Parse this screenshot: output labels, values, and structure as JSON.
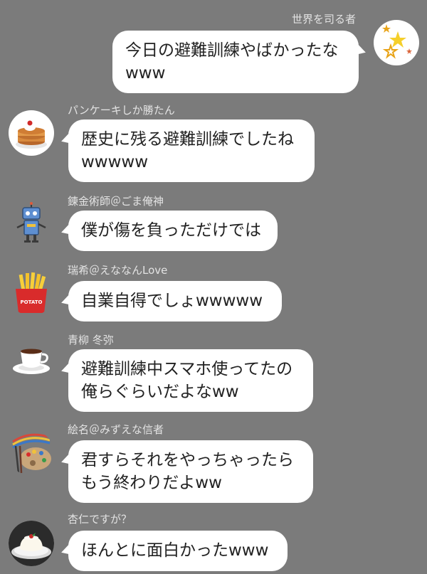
{
  "messages": [
    {
      "sender": "世界を司る者",
      "avatar_icon": "stars-avatar-icon",
      "lines": [
        "今日の避難訓練やばかったな",
        "www"
      ]
    },
    {
      "sender": "パンケーキしか勝たん",
      "avatar_icon": "pancake-avatar-icon",
      "lines": [
        "歴史に残る避難訓練でしたね",
        "wwwww"
      ]
    },
    {
      "sender": "錬金術師＠ごま俺神",
      "avatar_icon": "robot-avatar-icon",
      "lines": [
        "僕が傷を負っただけでは"
      ]
    },
    {
      "sender": "瑞希＠えななんLove",
      "avatar_icon": "fries-avatar-icon",
      "avatar_text": "POTATO",
      "lines": [
        "自業自得でしょwwwww"
      ]
    },
    {
      "sender": "青柳 冬弥",
      "avatar_icon": "coffee-avatar-icon",
      "lines": [
        "避難訓練中スマホ使ってたの",
        "俺らぐらいだよなww"
      ]
    },
    {
      "sender": "絵名＠みずえな信者",
      "avatar_icon": "palette-avatar-icon",
      "lines": [
        "君すらそれをやっちゃったら",
        "もう終わりだよww"
      ]
    },
    {
      "sender": "杏仁ですが？",
      "avatar_icon": "pudding-avatar-icon",
      "lines": [
        "ほんとに面白かったwww"
      ]
    }
  ],
  "colors": {
    "background": "#7b7b7b",
    "bubble": "#ffffff",
    "sender_text": "#e3e3e3"
  }
}
